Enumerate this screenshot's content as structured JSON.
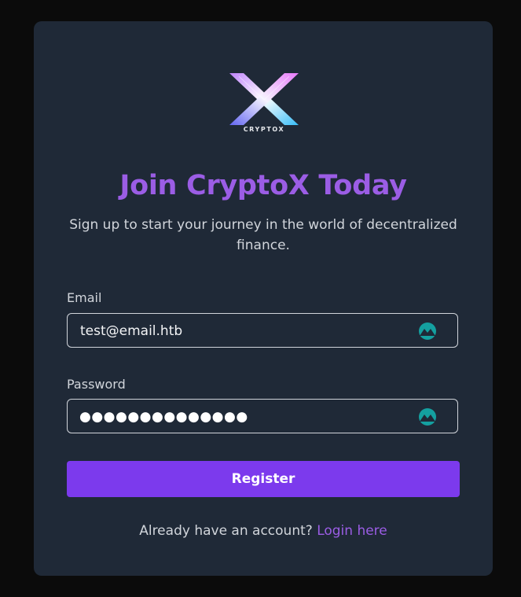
{
  "logo": {
    "text": "CRYPTOX",
    "icon": "cryptox-logo-icon"
  },
  "heading": "Join CryptoX Today",
  "subtitle": "Sign up to start your journey in the world of decentralized finance.",
  "email": {
    "label": "Email",
    "value": "test@email.htb",
    "icon": "password-manager-icon"
  },
  "password": {
    "label": "Password",
    "masked_value": "●●●●●●●●●●●●●●",
    "icon": "password-manager-icon"
  },
  "register_label": "Register",
  "footer": {
    "prompt": "Already have an account?",
    "link": "Login here"
  },
  "colors": {
    "background": "#0b0b0b",
    "card": "#1f2937",
    "accent": "#9b5de5",
    "button": "#7c3aed",
    "icon": "#14a0a0"
  }
}
